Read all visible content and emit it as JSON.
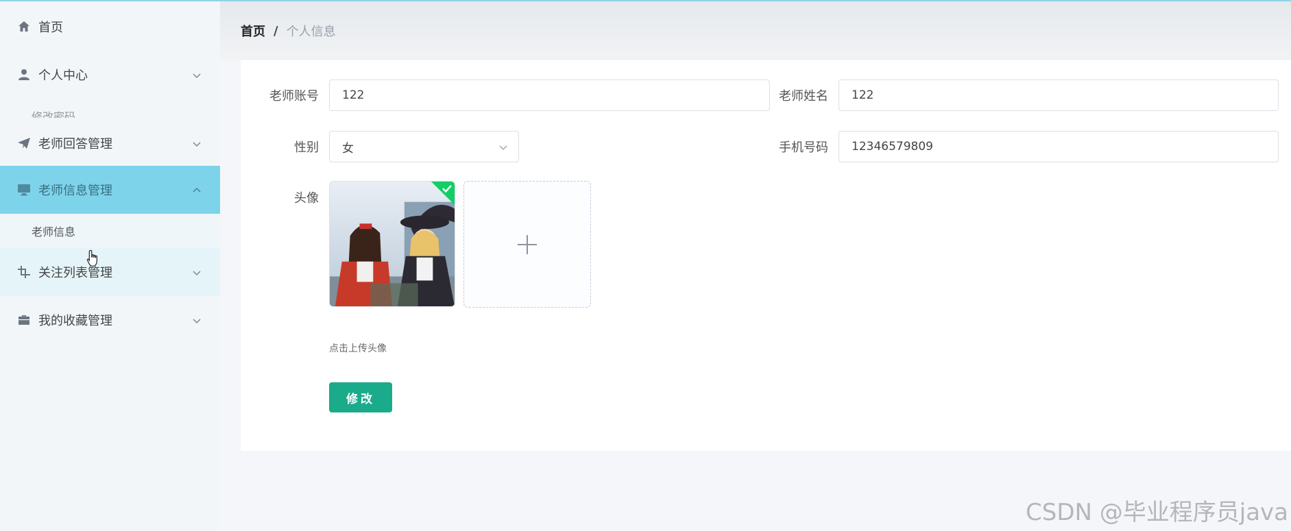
{
  "sidebar": {
    "items": [
      {
        "label": "首页",
        "icon": "home-icon"
      },
      {
        "label": "个人中心",
        "icon": "user-icon"
      },
      {
        "label": "老师回答管理",
        "icon": "paper-plane-icon"
      },
      {
        "label": "老师信息管理",
        "icon": "monitor-icon"
      },
      {
        "label": "关注列表管理",
        "icon": "crop-icon"
      },
      {
        "label": "我的收藏管理",
        "icon": "briefcase-icon"
      }
    ],
    "partial_sub_label": "修改密码",
    "active_sub_label": "老师信息"
  },
  "breadcrumb": {
    "home": "首页",
    "separator": "/",
    "current": "个人信息"
  },
  "form": {
    "account_label": "老师账号",
    "account_value": "122",
    "name_label": "老师姓名",
    "name_value": "122",
    "gender_label": "性别",
    "gender_value": "女",
    "phone_label": "手机号码",
    "phone_value": "12346579809",
    "avatar_label": "头像",
    "upload_hint": "点击上传头像",
    "submit_label": "修改"
  },
  "watermark": "CSDN @毕业程序员java",
  "colors": {
    "active_menu": "#7dd3ea",
    "primary_button": "#1aab8a",
    "success_badge": "#13ce66"
  }
}
